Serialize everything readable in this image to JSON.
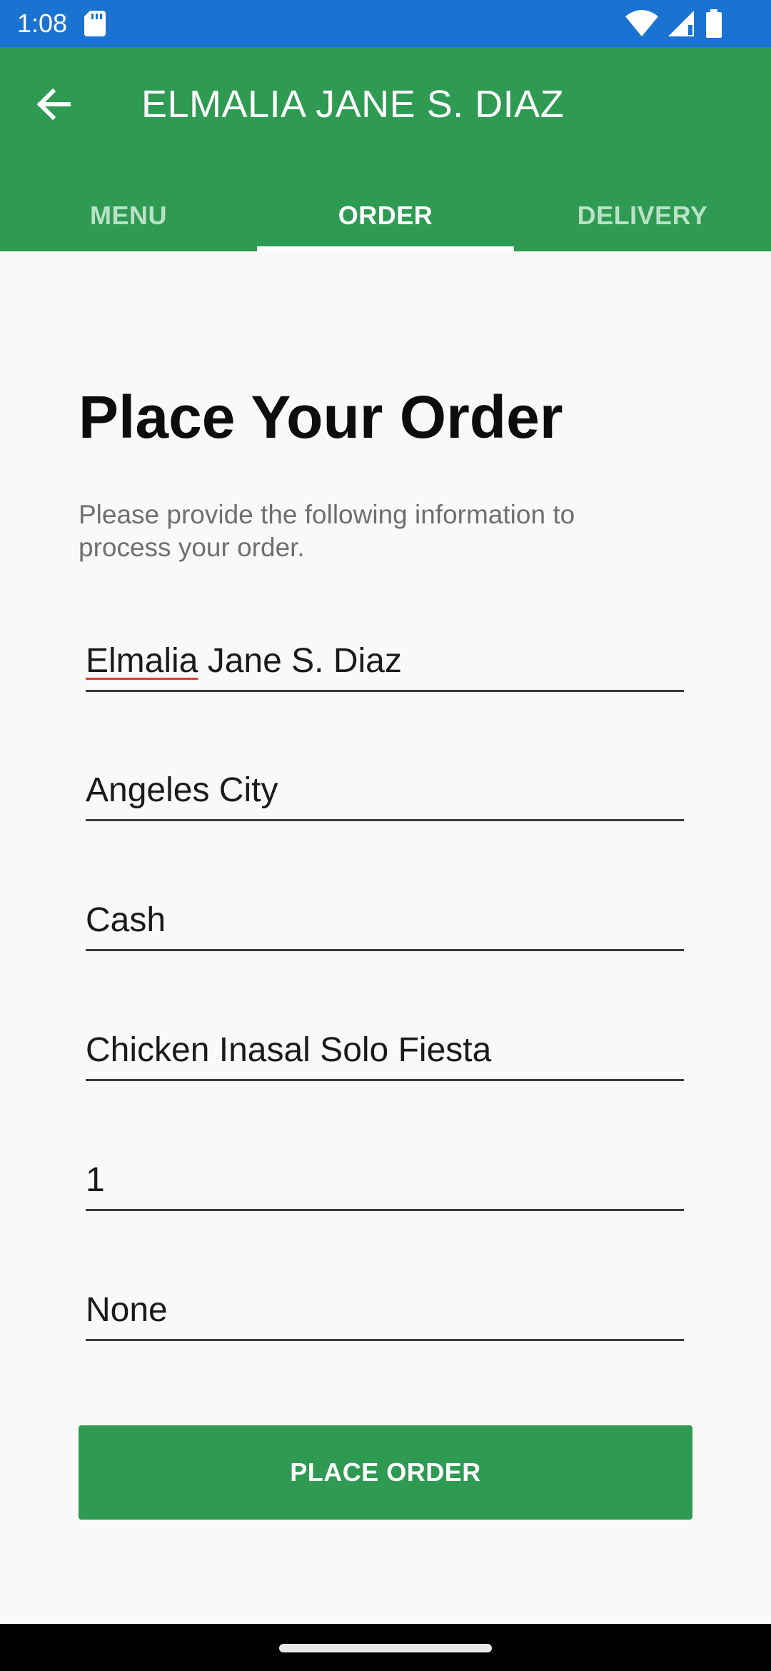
{
  "status_bar": {
    "time": "1:08",
    "icons": [
      "sd-card-icon",
      "wifi-icon",
      "cell-signal-icon",
      "battery-icon"
    ]
  },
  "app_bar": {
    "title": "ELMALIA JANE S. DIAZ",
    "back_icon": "arrow-left-icon",
    "color": "#2e9a52"
  },
  "tabs": [
    {
      "label": "MENU",
      "active": false
    },
    {
      "label": "ORDER",
      "active": true
    },
    {
      "label": "DELIVERY",
      "active": false
    }
  ],
  "main": {
    "title": "Place Your Order",
    "subtitle": "Please provide the following information to process your order.",
    "fields": [
      {
        "name": "name-field",
        "value_misspelled_part": "Elmalia",
        "value_rest": " Jane S. Diaz"
      },
      {
        "name": "address-field",
        "value": "Angeles City"
      },
      {
        "name": "payment-field",
        "value": "Cash"
      },
      {
        "name": "item-field",
        "value": "Chicken Inasal Solo Fiesta"
      },
      {
        "name": "quantity-field",
        "value": "1"
      },
      {
        "name": "notes-field",
        "value": "None"
      }
    ],
    "place_order_label": "PLACE ORDER"
  }
}
